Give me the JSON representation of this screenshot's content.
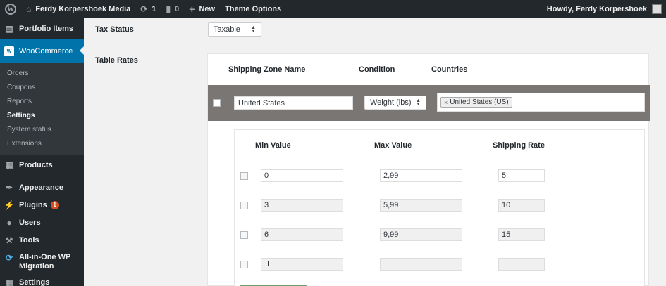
{
  "adminbar": {
    "site_name": "Ferdy Korpershoek Media",
    "updates_count": "1",
    "comments_count": "0",
    "new_label": "New",
    "theme_options_label": "Theme Options",
    "greeting": "Howdy, Ferdy Korpershoek"
  },
  "sidebar": {
    "portfolio": "Portfolio Items",
    "woocommerce": "WooCommerce",
    "submenu": [
      "Orders",
      "Coupons",
      "Reports",
      "Settings",
      "System status",
      "Extensions"
    ],
    "products": "Products",
    "appearance": "Appearance",
    "plugins": "Plugins",
    "plugins_badge": "1",
    "users": "Users",
    "tools": "Tools",
    "migration_line1": "All-in-One WP",
    "migration_line2": "Migration",
    "settings": "Settings"
  },
  "form": {
    "tax_status_label": "Tax Status",
    "tax_status_value": "Taxable",
    "table_rates_label": "Table Rates"
  },
  "zones": {
    "headers": {
      "zone_name": "Shipping Zone Name",
      "condition": "Condition",
      "countries": "Countries"
    },
    "row": {
      "zone_name": "United States",
      "condition": "Weight (lbs)",
      "country_tag": "United States (US)",
      "remove_glyph": "×"
    }
  },
  "rates": {
    "headers": {
      "min": "Min Value",
      "max": "Max Value",
      "rate": "Shipping Rate"
    },
    "rows": [
      {
        "min": "0",
        "max": "2,99",
        "rate": "5"
      },
      {
        "min": "3",
        "max": "5,99",
        "rate": "10"
      },
      {
        "min": "6",
        "max": "9,99",
        "rate": "15"
      },
      {
        "min": "",
        "max": "",
        "rate": ""
      }
    ],
    "cursor": "I"
  },
  "colors": {
    "admin_dark": "#23282d",
    "active_blue": "#0073aa",
    "zone_row_bg": "#7a7674",
    "badge": "#d54e21"
  }
}
